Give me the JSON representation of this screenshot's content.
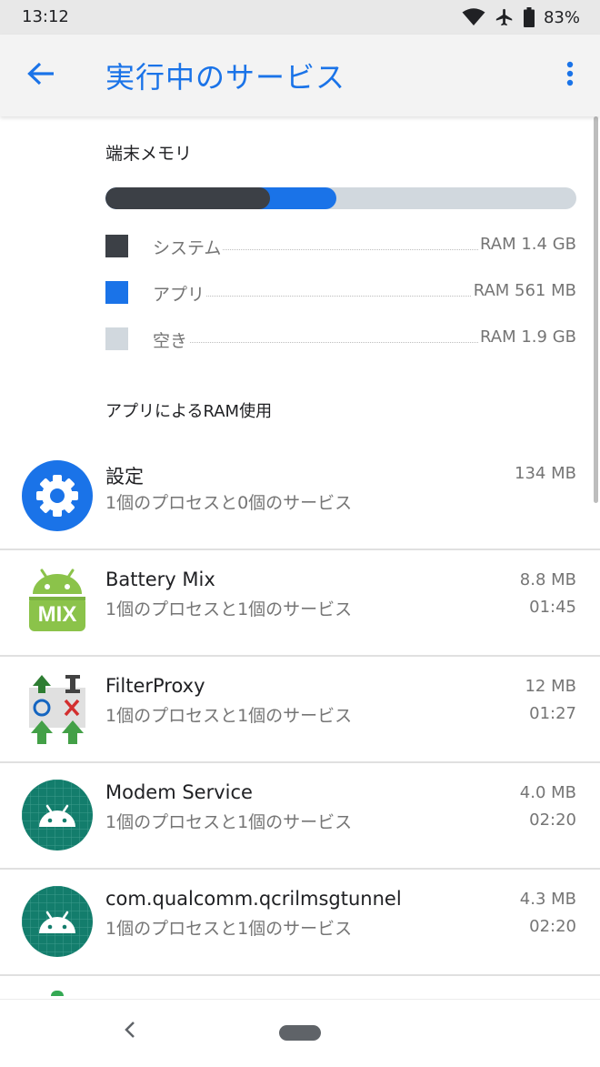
{
  "status_bar": {
    "time": "13:12",
    "battery_percent": "83%",
    "icons": [
      "wifi-icon",
      "airplane-icon",
      "battery-icon"
    ]
  },
  "app_bar": {
    "title": "実行中のサービス",
    "back_icon": "arrow-back-icon",
    "more_icon": "more-vert-icon"
  },
  "memory": {
    "section_title": "端末メモリ",
    "system_fraction": 0.35,
    "apps_fraction": 0.14,
    "legend": [
      {
        "label": "システム",
        "value": "RAM 1.4 GB",
        "color": "#3c4046"
      },
      {
        "label": "アプリ",
        "value": "RAM 561 MB",
        "color": "#1a73e8"
      },
      {
        "label": "空き",
        "value": "RAM 1.9 GB",
        "color": "#d1d8de"
      }
    ]
  },
  "apps_section_title": "アプリによるRAM使用",
  "apps": [
    {
      "name": "設定",
      "desc": "1個のプロセスと0個のサービス",
      "size": "134 MB",
      "time": "",
      "icon": "settings-gear-icon"
    },
    {
      "name": "Battery Mix",
      "desc": "1個のプロセスと1個のサービス",
      "size": "8.8 MB",
      "time": "01:45",
      "icon": "battery-mix-icon",
      "icon_text": "MIX"
    },
    {
      "name": "FilterProxy",
      "desc": "1個のプロセスと1個のサービス",
      "size": "12 MB",
      "time": "01:27",
      "icon": "filterproxy-icon"
    },
    {
      "name": "Modem Service",
      "desc": "1個のプロセスと1個のサービス",
      "size": "4.0 MB",
      "time": "02:20",
      "icon": "android-robot-icon"
    },
    {
      "name": "com.qualcomm.qcrilmsgtunnel",
      "desc": "1個のプロセスと1個のサービス",
      "size": "4.3 MB",
      "time": "02:20",
      "icon": "android-robot-icon"
    }
  ],
  "nav_bar": {
    "back_icon": "nav-back-icon",
    "home_icon": "nav-home-pill-icon"
  }
}
